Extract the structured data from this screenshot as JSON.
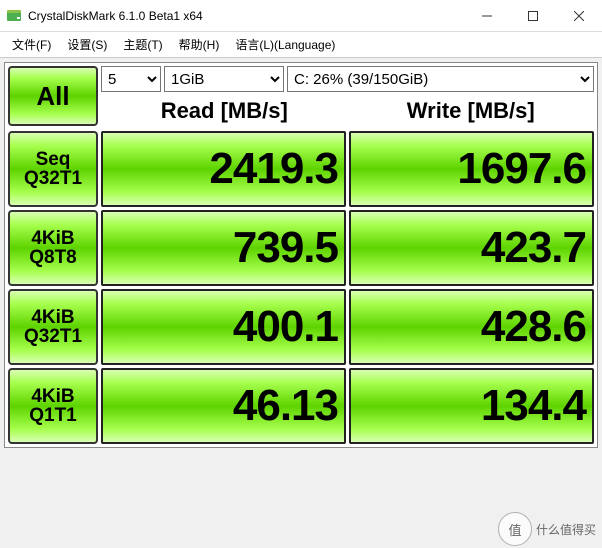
{
  "window": {
    "title": "CrystalDiskMark 6.1.0 Beta1 x64"
  },
  "menu": {
    "file": "文件(F)",
    "settings": "设置(S)",
    "theme": "主题(T)",
    "help": "帮助(H)",
    "language": "语言(L)(Language)"
  },
  "controls": {
    "loops": "5",
    "size": "1GiB",
    "drive": "C: 26% (39/150GiB)"
  },
  "headers": {
    "read": "Read [MB/s]",
    "write": "Write [MB/s]"
  },
  "buttons": {
    "all": "All",
    "tests": [
      {
        "l1": "Seq",
        "l2": "Q32T1"
      },
      {
        "l1": "4KiB",
        "l2": "Q8T8"
      },
      {
        "l1": "4KiB",
        "l2": "Q32T1"
      },
      {
        "l1": "4KiB",
        "l2": "Q1T1"
      }
    ]
  },
  "results": {
    "rows": [
      {
        "read": "2419.3",
        "write": "1697.6"
      },
      {
        "read": "739.5",
        "write": "423.7"
      },
      {
        "read": "400.1",
        "write": "428.6"
      },
      {
        "read": "46.13",
        "write": "134.4"
      }
    ]
  },
  "watermark": {
    "badge": "值",
    "text": "什么值得买"
  },
  "chart_data": {
    "type": "table",
    "title": "CrystalDiskMark 6.1.0 benchmark",
    "columns": [
      "Test",
      "Read [MB/s]",
      "Write [MB/s]"
    ],
    "rows": [
      [
        "Seq Q32T1",
        2419.3,
        1697.6
      ],
      [
        "4KiB Q8T8",
        739.5,
        423.7
      ],
      [
        "4KiB Q32T1",
        400.1,
        428.6
      ],
      [
        "4KiB Q1T1",
        46.13,
        134.4
      ]
    ],
    "drive": "C: 26% (39/150GiB)",
    "test_size": "1GiB",
    "loops": 5
  }
}
